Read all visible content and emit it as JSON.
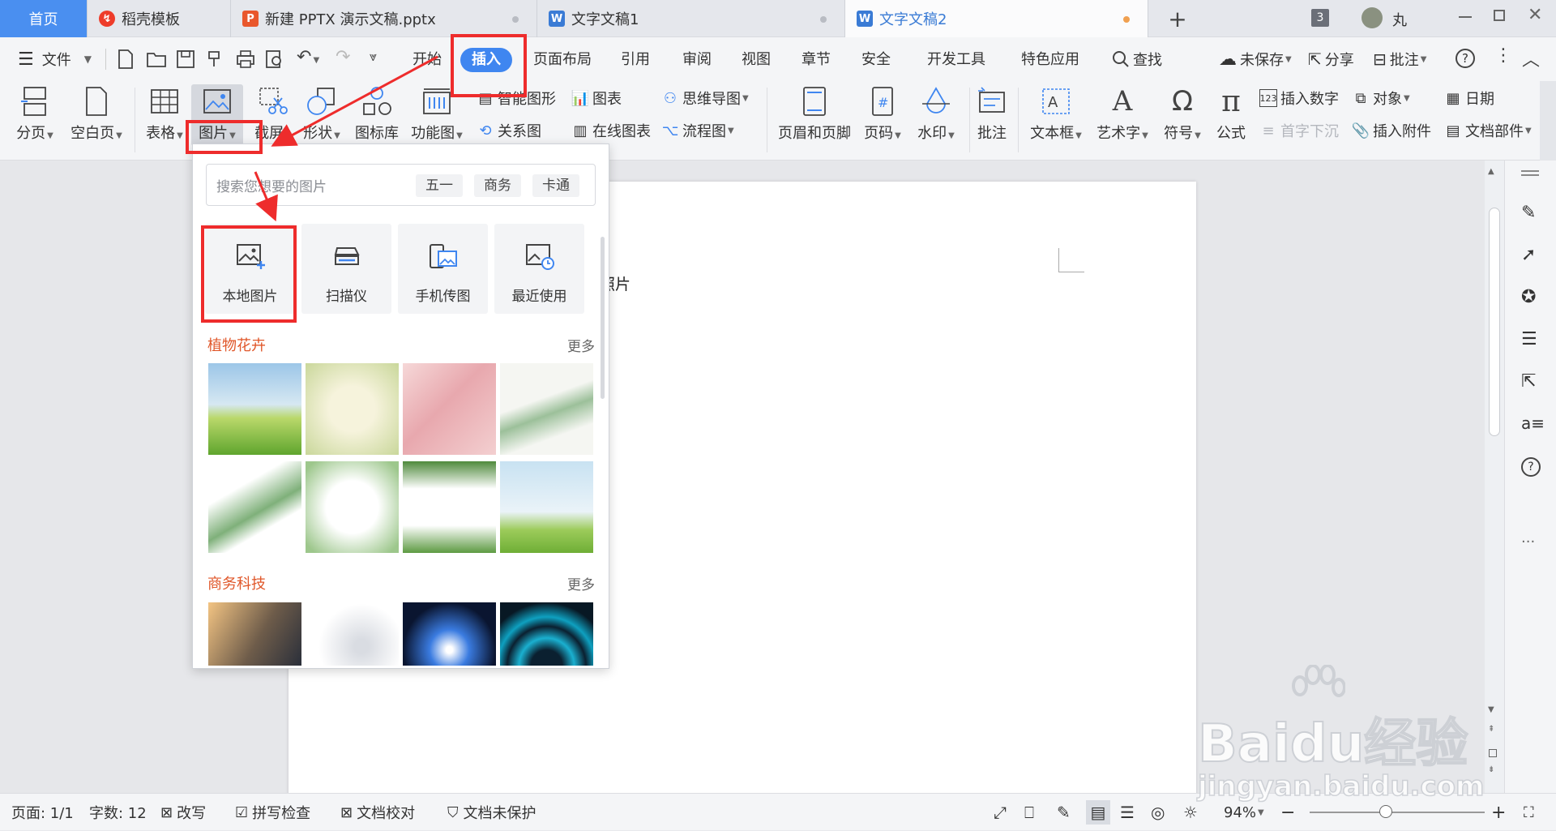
{
  "tabs": {
    "home": "首页",
    "template": "稻壳模板",
    "pptx": "新建 PPTX 演示文稿.pptx",
    "doc1": "文字文稿1",
    "doc2": "文字文稿2",
    "counter": "3",
    "user": "丸"
  },
  "menu": {
    "file": "文件",
    "start": "开始",
    "insert": "插入",
    "layout": "页面布局",
    "reference": "引用",
    "review": "审阅",
    "view": "视图",
    "chapter": "章节",
    "security": "安全",
    "devtools": "开发工具",
    "special": "特色应用",
    "search": "查找",
    "unsaved": "未保存",
    "share": "分享",
    "comment": "批注"
  },
  "ribbon": {
    "page_break": "分页",
    "blank_page": "空白页",
    "table": "表格",
    "picture": "图片",
    "screenshot": "截屏",
    "shape": "形状",
    "icon_lib": "图标库",
    "func_chart": "功能图",
    "smart_shape": "智能图形",
    "chart": "图表",
    "mind_map": "思维导图",
    "relation": "关系图",
    "online_chart": "在线图表",
    "flowchart": "流程图",
    "header_footer": "页眉和页脚",
    "page_num": "页码",
    "watermark": "水印",
    "annotate": "批注",
    "textbox": "文本框",
    "art_text": "艺术字",
    "symbol": "符号",
    "formula": "公式",
    "insert_number": "插入数字",
    "object": "对象",
    "date": "日期",
    "drop_cap": "首字下沉",
    "attachment": "插入附件",
    "doc_parts": "文档部件"
  },
  "panel": {
    "search_placeholder": "搜索您想要的图片",
    "chips": [
      "五一",
      "商务",
      "卡通"
    ],
    "sources": [
      "本地图片",
      "扫描仪",
      "手机传图",
      "最近使用"
    ],
    "section1": "植物花卉",
    "section2": "商务科技",
    "more": "更多"
  },
  "document": {
    "text_fragment": "照片"
  },
  "status": {
    "page": "页面: 1/1",
    "words": "字数: 12",
    "revise": "改写",
    "spellcheck": "拼写检查",
    "proofread": "文档校对",
    "protect": "文档未保护",
    "zoom": "94%"
  },
  "watermark": {
    "brand": "Baidu经验",
    "url": "jingyan.baidu.com"
  },
  "colors": {
    "accent": "#3f86f0",
    "annotation_red": "#ee2c2c",
    "section_title": "#e0572a"
  }
}
